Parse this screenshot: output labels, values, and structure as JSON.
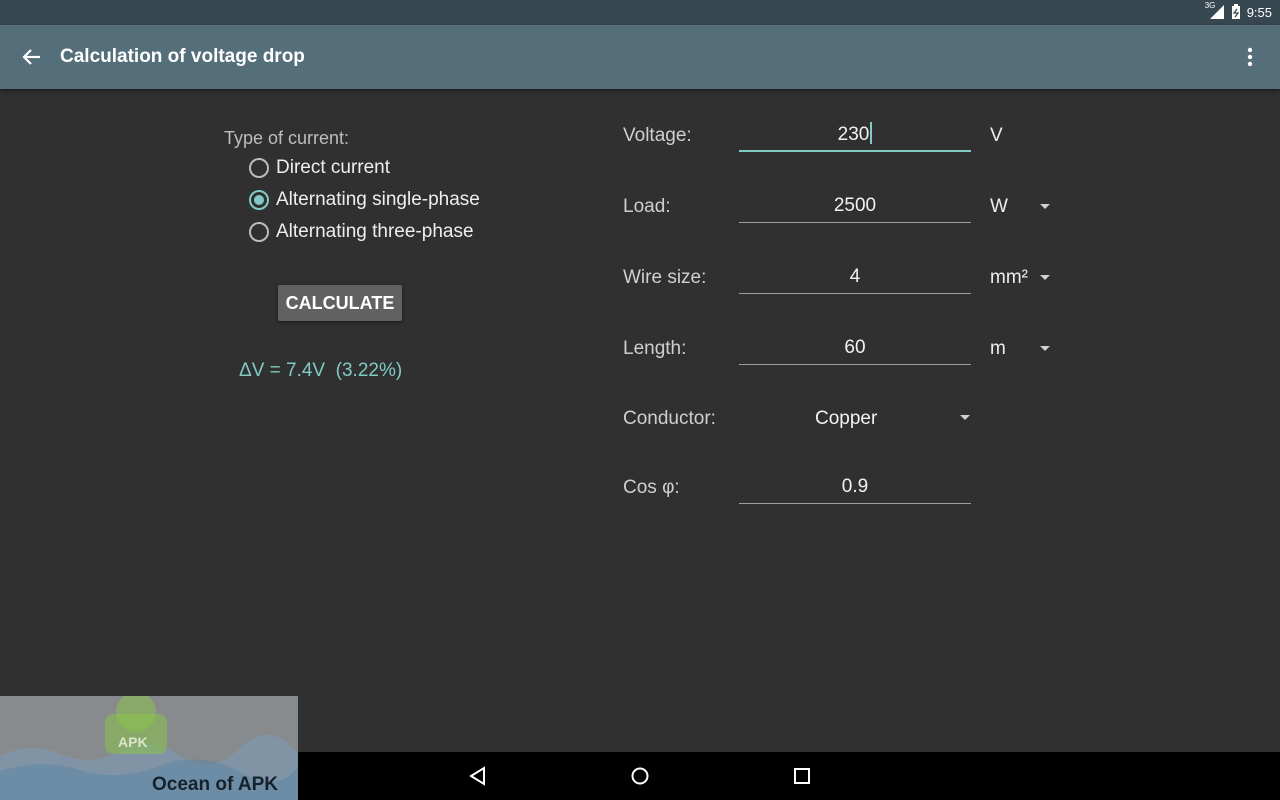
{
  "status_bar": {
    "network": "3G",
    "time": "9:55"
  },
  "app_bar": {
    "title": "Calculation of voltage drop"
  },
  "current_type": {
    "label": "Type of current:",
    "options": [
      "Direct current",
      "Alternating single-phase",
      "Alternating three-phase"
    ],
    "selected": "Alternating single-phase"
  },
  "calculate_button": {
    "label": "CALCULATE"
  },
  "result": {
    "text": "ΔV = 7.4V  (3.22%)"
  },
  "fields": {
    "voltage": {
      "label": "Voltage:",
      "value": "230",
      "unit": "V"
    },
    "load": {
      "label": "Load:",
      "value": "2500",
      "unit": "W"
    },
    "wire_size": {
      "label": "Wire size:",
      "value": "4",
      "unit": "mm²"
    },
    "length": {
      "label": "Length:",
      "value": "60",
      "unit": "m"
    },
    "conductor": {
      "label": "Conductor:",
      "value": "Copper"
    },
    "cos_phi": {
      "label": "Cos φ:",
      "value": "0.9"
    }
  },
  "watermark": {
    "text": "Ocean of APK",
    "badge": "APK"
  },
  "colors": {
    "accent": "#80cbc4",
    "app_bar": "#546e7a",
    "status_bar": "#37474f",
    "background": "#303030"
  },
  "icons": [
    "back-arrow-icon",
    "overflow-menu-icon",
    "signal-icon",
    "battery-icon",
    "nav-back-icon",
    "nav-home-icon",
    "nav-recents-icon"
  ]
}
